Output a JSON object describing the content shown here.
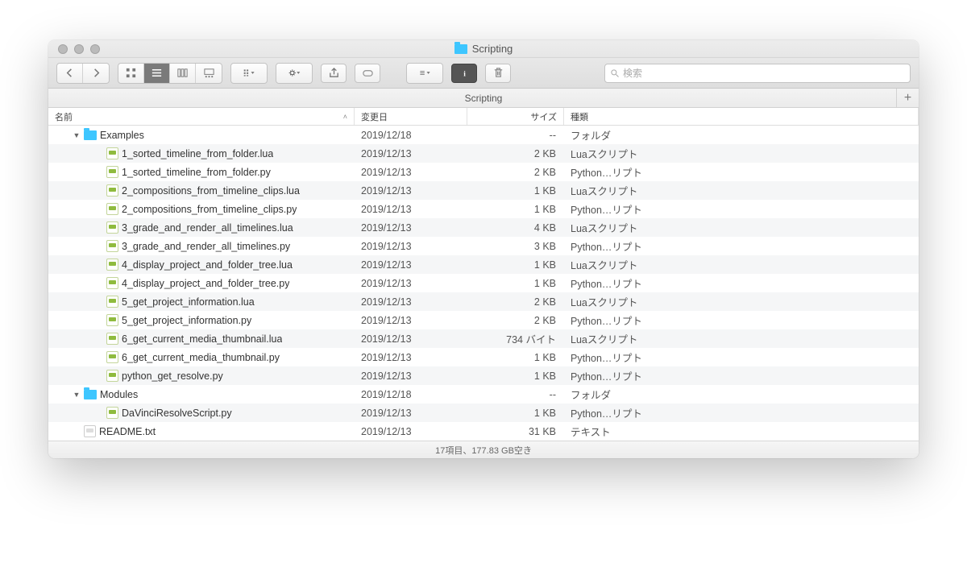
{
  "window_title": "Scripting",
  "pathbar_label": "Scripting",
  "toolbar": {
    "search_placeholder": "検索"
  },
  "columns": {
    "name": "名前",
    "date": "変更日",
    "size": "サイズ",
    "kind": "種類"
  },
  "kinds": {
    "folder": "フォルダ",
    "lua": "Luaスクリプト",
    "python": "Python…リプト",
    "text": "テキスト"
  },
  "rows": [
    {
      "name": "Examples",
      "date": "2019/12/18",
      "size": "--",
      "kind": "folder",
      "indent": 1,
      "type": "folder",
      "expanded": true
    },
    {
      "name": "1_sorted_timeline_from_folder.lua",
      "date": "2019/12/13",
      "size": "2 KB",
      "kind": "lua",
      "indent": 2,
      "type": "lua"
    },
    {
      "name": "1_sorted_timeline_from_folder.py",
      "date": "2019/12/13",
      "size": "2 KB",
      "kind": "python",
      "indent": 2,
      "type": "py"
    },
    {
      "name": "2_compositions_from_timeline_clips.lua",
      "date": "2019/12/13",
      "size": "1 KB",
      "kind": "lua",
      "indent": 2,
      "type": "lua"
    },
    {
      "name": "2_compositions_from_timeline_clips.py",
      "date": "2019/12/13",
      "size": "1 KB",
      "kind": "python",
      "indent": 2,
      "type": "py"
    },
    {
      "name": "3_grade_and_render_all_timelines.lua",
      "date": "2019/12/13",
      "size": "4 KB",
      "kind": "lua",
      "indent": 2,
      "type": "lua"
    },
    {
      "name": "3_grade_and_render_all_timelines.py",
      "date": "2019/12/13",
      "size": "3 KB",
      "kind": "python",
      "indent": 2,
      "type": "py"
    },
    {
      "name": "4_display_project_and_folder_tree.lua",
      "date": "2019/12/13",
      "size": "1 KB",
      "kind": "lua",
      "indent": 2,
      "type": "lua"
    },
    {
      "name": "4_display_project_and_folder_tree.py",
      "date": "2019/12/13",
      "size": "1 KB",
      "kind": "python",
      "indent": 2,
      "type": "py"
    },
    {
      "name": "5_get_project_information.lua",
      "date": "2019/12/13",
      "size": "2 KB",
      "kind": "lua",
      "indent": 2,
      "type": "lua"
    },
    {
      "name": "5_get_project_information.py",
      "date": "2019/12/13",
      "size": "2 KB",
      "kind": "python",
      "indent": 2,
      "type": "py"
    },
    {
      "name": "6_get_current_media_thumbnail.lua",
      "date": "2019/12/13",
      "size": "734 バイト",
      "kind": "lua",
      "indent": 2,
      "type": "lua"
    },
    {
      "name": "6_get_current_media_thumbnail.py",
      "date": "2019/12/13",
      "size": "1 KB",
      "kind": "python",
      "indent": 2,
      "type": "py"
    },
    {
      "name": "python_get_resolve.py",
      "date": "2019/12/13",
      "size": "1 KB",
      "kind": "python",
      "indent": 2,
      "type": "py"
    },
    {
      "name": "Modules",
      "date": "2019/12/18",
      "size": "--",
      "kind": "folder",
      "indent": 1,
      "type": "folder",
      "expanded": true
    },
    {
      "name": "DaVinciResolveScript.py",
      "date": "2019/12/13",
      "size": "1 KB",
      "kind": "python",
      "indent": 2,
      "type": "py"
    },
    {
      "name": "README.txt",
      "date": "2019/12/13",
      "size": "31 KB",
      "kind": "text",
      "indent": 1,
      "type": "txt"
    }
  ],
  "status": "17項目、177.83 GB空き"
}
